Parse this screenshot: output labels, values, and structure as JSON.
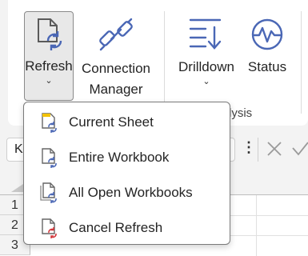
{
  "ribbon": {
    "refresh_label": "Refresh",
    "connection_label_1": "Connection",
    "connection_label_2": "Manager",
    "drilldown_label": "Drilldown",
    "status_label": "Status",
    "group_label_partial": "lysis",
    "accent_color": "#4a67b5",
    "chevron": "⌄"
  },
  "formula_bar": {
    "namebox_partial": "K",
    "more_icon": "⋮"
  },
  "grid": {
    "row_headers": [
      "1",
      "2",
      "3"
    ]
  },
  "refresh_menu": {
    "items": [
      {
        "label": "Current Sheet",
        "icon": "current-sheet-refresh-icon"
      },
      {
        "label": "Entire Workbook",
        "icon": "workbook-refresh-icon"
      },
      {
        "label": "All Open Workbooks",
        "icon": "all-workbooks-refresh-icon"
      },
      {
        "label": "Cancel Refresh",
        "icon": "cancel-refresh-icon"
      }
    ]
  }
}
